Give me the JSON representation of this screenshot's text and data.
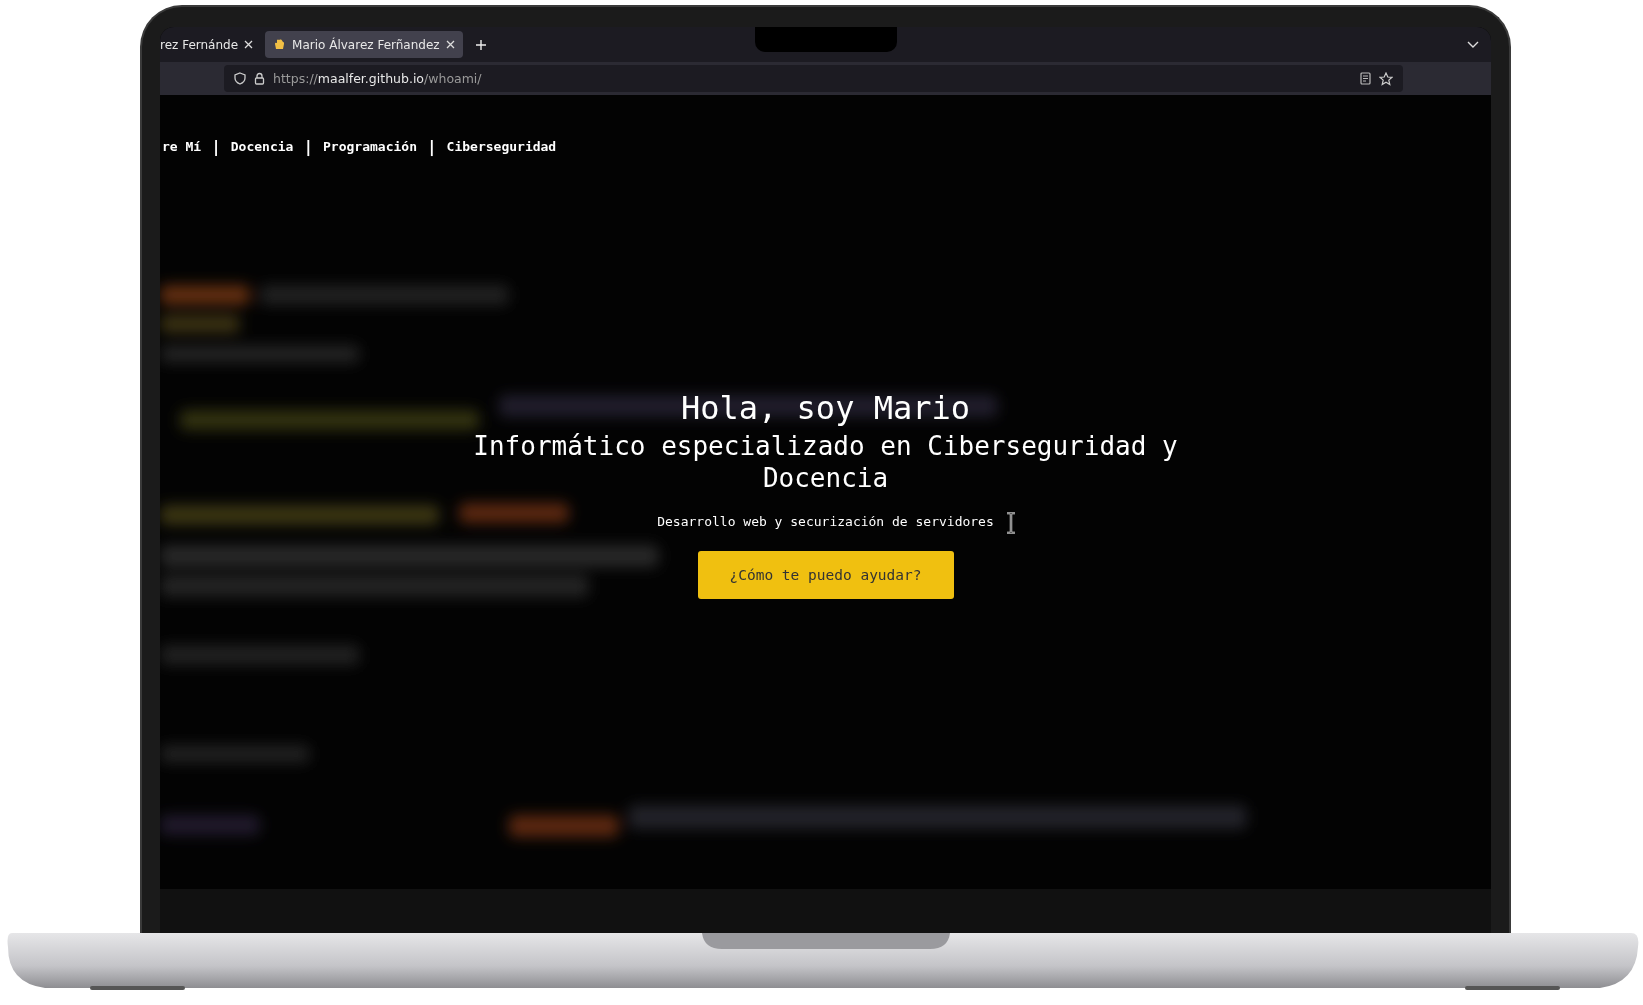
{
  "browser": {
    "tabs": [
      {
        "title": "rez Fernánde",
        "selected": false
      },
      {
        "title": "Mario Álvarez Ferñandez",
        "selected": true
      }
    ],
    "url": {
      "scheme": "https://",
      "host": "maalfer.github.io",
      "path": "/whoami/"
    }
  },
  "nav": {
    "separator": "|",
    "items": [
      {
        "label": "re Mí"
      },
      {
        "label": "Docencia"
      },
      {
        "label": "Programación"
      },
      {
        "label": "Ciberseguridad"
      }
    ]
  },
  "hero": {
    "title": "Hola, soy Mario",
    "subtitle": "Informático especializado en Ciberseguridad y Docencia",
    "tagline": "Desarrollo web y securización de servidores",
    "button": "¿Cómo te puedo ayudar?"
  }
}
